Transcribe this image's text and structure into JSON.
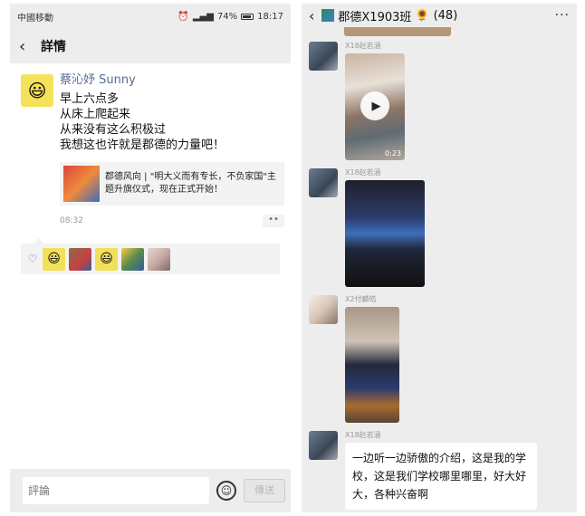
{
  "left": {
    "status": {
      "carrier": "中國移動",
      "battery": "74%",
      "time": "18:17"
    },
    "nav": {
      "title": "詳情"
    },
    "post": {
      "author": "蔡沁妤 Sunny",
      "lines": [
        "早上六点多",
        "从床上爬起来",
        "从来没有这么积极过",
        "我想这也许就是郡德的力量吧！"
      ],
      "link_text": "郡德风向 | \"明大义而有专长，不负家国\"主题升旗仪式，现在正式开始！",
      "time": "08:32",
      "more": "••"
    },
    "comment": {
      "placeholder": "評論",
      "send_label": "傳送"
    }
  },
  "right": {
    "title": "郡德X1903班",
    "count": "(48)",
    "messages": [
      {
        "sender": "X18赵若涵",
        "duration": "0:23"
      },
      {
        "sender": "X18赵若涵"
      },
      {
        "sender": "X2付麟皓"
      },
      {
        "sender": "X18赵若涵",
        "text": "一边听一边骄傲的介绍，这是我的学校，这是我们学校哪里哪里，好大好大，各种兴奋啊"
      }
    ]
  },
  "colors": {
    "link_blue": "#576b95",
    "bar_gray": "#ededed"
  }
}
